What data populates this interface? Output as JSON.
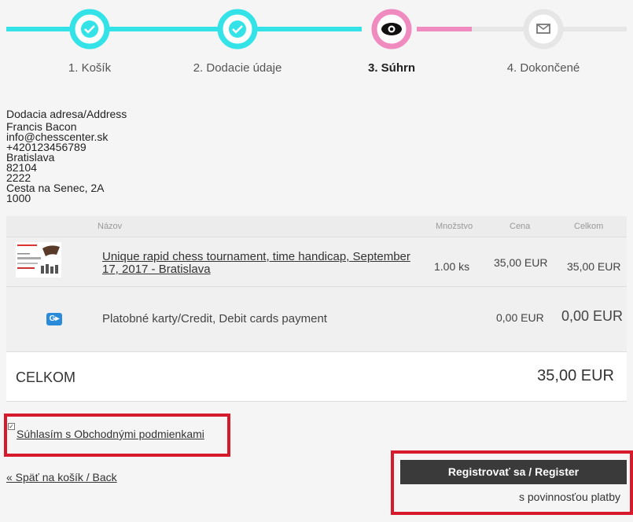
{
  "steps": [
    {
      "label": "1. Košík",
      "state": "done"
    },
    {
      "label": "2. Dodacie údaje",
      "state": "done"
    },
    {
      "label": "3. Súhrn",
      "state": "active"
    },
    {
      "label": "4. Dokončené",
      "state": "pending"
    }
  ],
  "colors": {
    "done": "#33e3e8",
    "active": "#f08bc0",
    "pending": "#e2e2e2"
  },
  "address": {
    "heading": "Dodacia adresa/Address",
    "lines": [
      "Francis Bacon",
      "info@chesscenter.sk",
      "+420123456789",
      "Bratislava",
      "82104",
      "2222",
      "Cesta na Senec, 2A",
      "1000"
    ]
  },
  "table": {
    "headers": {
      "name": "Názov",
      "qty": "Množstvo",
      "price": "Cena",
      "total": "Celkom"
    },
    "rows": [
      {
        "name": "Unique rapid chess tournament, time handicap, September 17, 2017 - Bratislava",
        "qty": "1.00 ks",
        "price": "35,00 EUR",
        "total": "35,00 EUR"
      },
      {
        "icon": "google-pay-icon",
        "name": "Platobné karty/Credit, Debit cards payment",
        "price": "0,00 EUR",
        "total": "0,00 EUR"
      }
    ],
    "grand_total_label": "CELKOM",
    "grand_total_value": "35,00 EUR"
  },
  "terms": {
    "label": "Súhlasím s Obchodnými podmienkami",
    "checked": true
  },
  "back_link": "« Späť na košík / Back",
  "register": {
    "label": "Registrovať sa / Register",
    "note": "s povinnosťou platby"
  }
}
